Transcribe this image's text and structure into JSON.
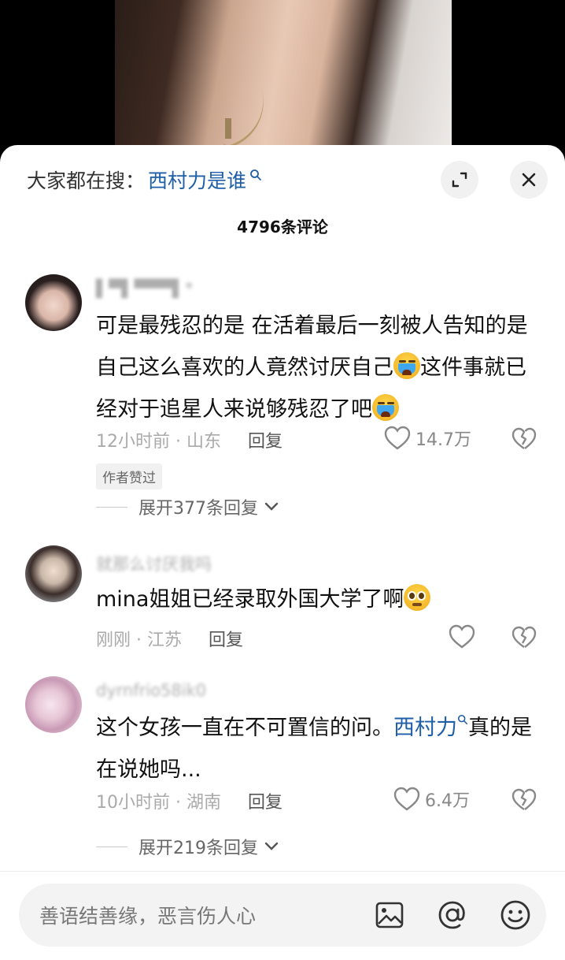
{
  "search": {
    "prefix": "大家都在搜：",
    "term": "西村力是谁"
  },
  "comment_count": "4796条评论",
  "comments": [
    {
      "username": "▌▀▌▀▀▀▌*",
      "text_parts": [
        "可是最残忍的是 在活着最后一刻被人告知的是自己这么喜欢的人竟然讨厌自己",
        "这件事就已经对于追星人来说够残忍了吧"
      ],
      "emoji": "loudly-crying-face",
      "time_location": "12小时前 · 山东",
      "reply_label": "回复",
      "likes": "14.7万",
      "badge": "作者赞过",
      "expand_replies": "展开377条回复"
    },
    {
      "username": "就那么讨厌我吗",
      "text": "mina姐姐已经录取外国大学了啊",
      "emoji": "pleading-face",
      "time_location": "刚刚 · 江苏",
      "reply_label": "回复"
    },
    {
      "username": "dyrnfrio58ik0",
      "text_before": "这个女孩一直在不可置信的问。",
      "link_term": "西村力",
      "text_after": "真的是在说她吗...",
      "time_location": "10小时前 · 湖南",
      "reply_label": "回复",
      "likes": "6.4万",
      "expand_replies": "展开219条回复"
    }
  ],
  "input": {
    "placeholder": "善语结善缘，恶言伤人心"
  },
  "colors": {
    "link": "#1f5ea8",
    "sheet_bg": "#ffffff",
    "muted": "#aaaaaa"
  },
  "icons": [
    "search-icon",
    "expand-icon",
    "close-icon",
    "heart-icon",
    "dislike-heart-icon",
    "image-icon",
    "at-icon",
    "emoji-icon"
  ]
}
